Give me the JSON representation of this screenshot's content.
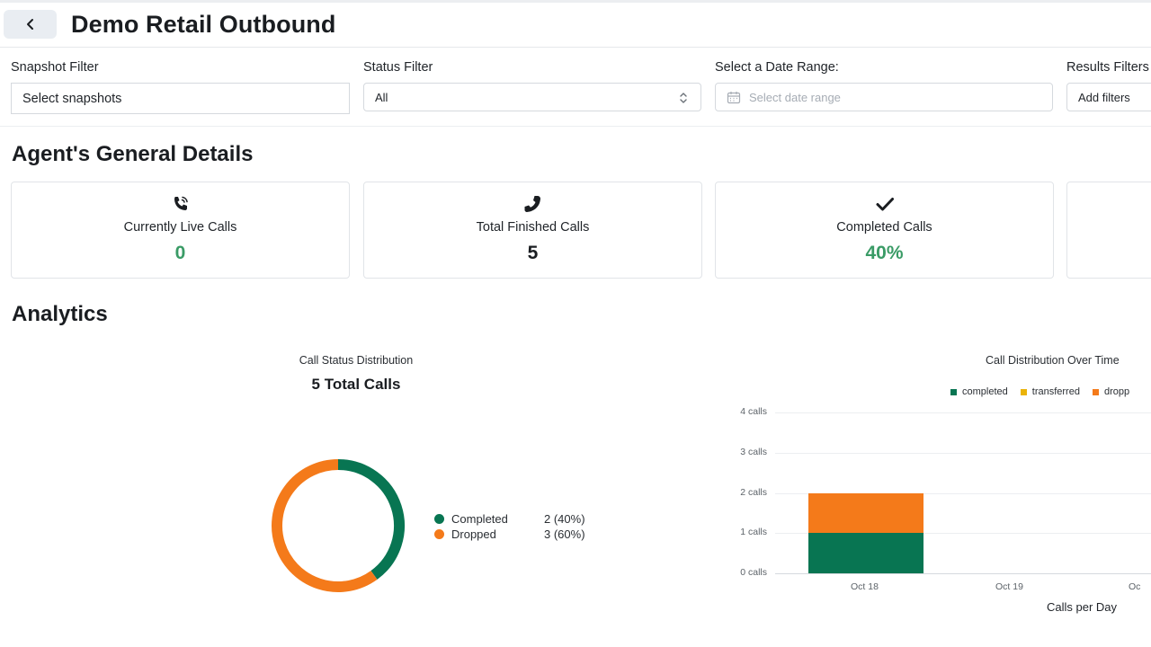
{
  "header": {
    "title": "Demo Retail Outbound"
  },
  "filters": {
    "snapshot": {
      "label": "Snapshot Filter",
      "value": "Select snapshots"
    },
    "status": {
      "label": "Status Filter",
      "value": "All"
    },
    "date": {
      "label": "Select a Date Range:",
      "placeholder": "Select date range"
    },
    "results": {
      "label": "Results Filters",
      "value": "Add filters"
    }
  },
  "sections": {
    "details": "Agent's General Details",
    "analytics": "Analytics"
  },
  "cards": [
    {
      "icon": "phone-ringing-icon",
      "label": "Currently Live Calls",
      "value": "0",
      "color": "#3a9b66"
    },
    {
      "icon": "phone-icon",
      "label": "Total Finished Calls",
      "value": "5",
      "color": "#1a1d21"
    },
    {
      "icon": "checkmark-icon",
      "label": "Completed Calls",
      "value": "40%",
      "color": "#3a9b66"
    }
  ],
  "colors": {
    "completed": "#087552",
    "transferred": "#eab308",
    "dropped": "#f47a1a"
  },
  "chart_data": [
    {
      "type": "pie",
      "title": "Call Status Distribution",
      "subtitle": "5 Total Calls",
      "categories": [
        "Completed",
        "Dropped"
      ],
      "values": [
        2,
        3
      ],
      "value_labels": [
        "2 (40%)",
        "3 (60%)"
      ],
      "legend": "right"
    },
    {
      "type": "bar",
      "title": "Call Distribution Over Time",
      "categories": [
        "Oct 18",
        "Oct 19",
        "Oc"
      ],
      "series": [
        {
          "name": "completed",
          "values": [
            1,
            0,
            0
          ]
        },
        {
          "name": "transferred",
          "values": [
            0,
            0,
            0
          ]
        },
        {
          "name": "dropp",
          "values": [
            1,
            0,
            0
          ]
        }
      ],
      "stacked": true,
      "ylim": [
        0,
        4
      ],
      "yticks": [
        "0 calls",
        "1 calls",
        "2 calls",
        "3 calls",
        "4 calls"
      ],
      "xlabel": "Calls per Day",
      "ylabel": "",
      "grid": true,
      "legend": "top"
    }
  ]
}
